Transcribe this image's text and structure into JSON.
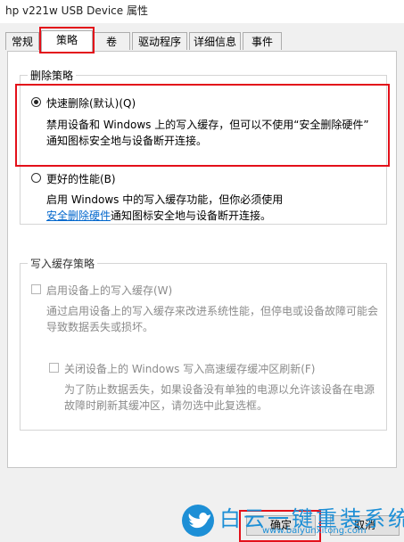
{
  "window": {
    "title": "hp v221w USB Device 属性"
  },
  "tabs": [
    {
      "label": "常规"
    },
    {
      "label": "策略",
      "selected": true
    },
    {
      "label": "卷"
    },
    {
      "label": "驱动程序"
    },
    {
      "label": "详细信息"
    },
    {
      "label": "事件"
    }
  ],
  "removal_policy": {
    "title": "删除策略",
    "quick": {
      "label": "快速删除(默认)(Q)",
      "selected": true,
      "desc_line1": "禁用设备和 Windows 上的写入缓存，但可以不使用“安全删除硬件”",
      "desc_line2": "通知图标安全地与设备断开连接。"
    },
    "better": {
      "label": "更好的性能(B)",
      "selected": false,
      "desc_line1": "启用 Windows 中的写入缓存功能，但你必须使用",
      "link": "安全删除硬件",
      "desc_line2_rest": "通知图标安全地与设备断开连接。"
    }
  },
  "write_cache_policy": {
    "title": "写入缓存策略",
    "enable": {
      "label": "启用设备上的写入缓存(W)",
      "checked": false,
      "desc_line1": "通过启用设备上的写入缓存来改进系统性能，但停电或设备故障可能会",
      "desc_line2": "导致数据丢失或损坏。"
    },
    "flush": {
      "label": "关闭设备上的 Windows 写入高速缓存缓冲区刷新(F)",
      "checked": false,
      "desc_line1": "为了防止数据丢失，如果设备没有单独的电源以允许该设备在电源",
      "desc_line2": "故障时刷新其缓冲区，请勿选中此复选框。"
    }
  },
  "buttons": {
    "ok": "确定",
    "cancel": "取消"
  },
  "watermark": {
    "text": "白云一键重装系统",
    "url": "www.baiyunxitong.com"
  },
  "colors": {
    "highlight": "#e3101a",
    "link": "#0066cc",
    "watermark": "#1d8fd6"
  }
}
